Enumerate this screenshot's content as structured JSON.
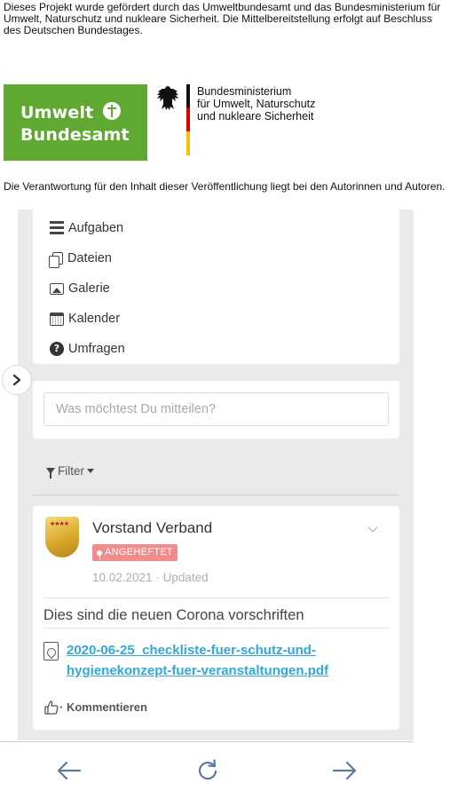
{
  "funding": {
    "text": "Dieses Projekt wurde gefördert durch das Umweltbundesamt und das Bundesministerium für Umwelt, Naturschutz und nukleare Sicherheit. Die Mittelbereitstellung erfolgt auf Beschluss des Deutschen Bundestages."
  },
  "logos": {
    "uba": {
      "line1": "Umwelt",
      "line2": "Bundesamt",
      "color": "#5fa832"
    },
    "ministry": {
      "line1": "Bundesministerium",
      "line2": "für Umwelt, Naturschutz",
      "line3": "und nukleare Sicherheit"
    }
  },
  "responsibility": {
    "text": "Die Verantwortung für den Inhalt dieser Veröffentlichung liegt bei den Autorinnen und Autoren."
  },
  "menu": {
    "items": [
      {
        "label": "Aufgaben",
        "icon": "tasks-icon"
      },
      {
        "label": "Dateien",
        "icon": "files-icon"
      },
      {
        "label": "Galerie",
        "icon": "gallery-icon"
      },
      {
        "label": "Kalender",
        "icon": "calendar-icon"
      },
      {
        "label": "Umfragen",
        "icon": "question-circle-icon"
      }
    ]
  },
  "sidebar_toggle": {
    "icon": "chevron-right-icon"
  },
  "composer": {
    "placeholder": "Was möchtest Du mitteilen?"
  },
  "filter": {
    "label": "Filter"
  },
  "post": {
    "author": "Vorstand Verband",
    "badge": "ANGEHEFTET",
    "badge_color": "#f08c8c",
    "date": "10.02.2021",
    "status": "Updated",
    "meta": "10.02.2021 · Updated",
    "text": "Dies sind die neuen Corona vorschriften",
    "attachment": "2020-06-25_checkliste-fuer-schutz-und-hygienekonzept-fuer-veranstaltungen.pdf",
    "comment_label": "· Kommentieren",
    "link_color": "#33a8d6"
  },
  "browser_nav": {
    "back_icon": "arrow-left-icon",
    "reload_icon": "reload-icon",
    "forward_icon": "arrow-right-icon"
  }
}
